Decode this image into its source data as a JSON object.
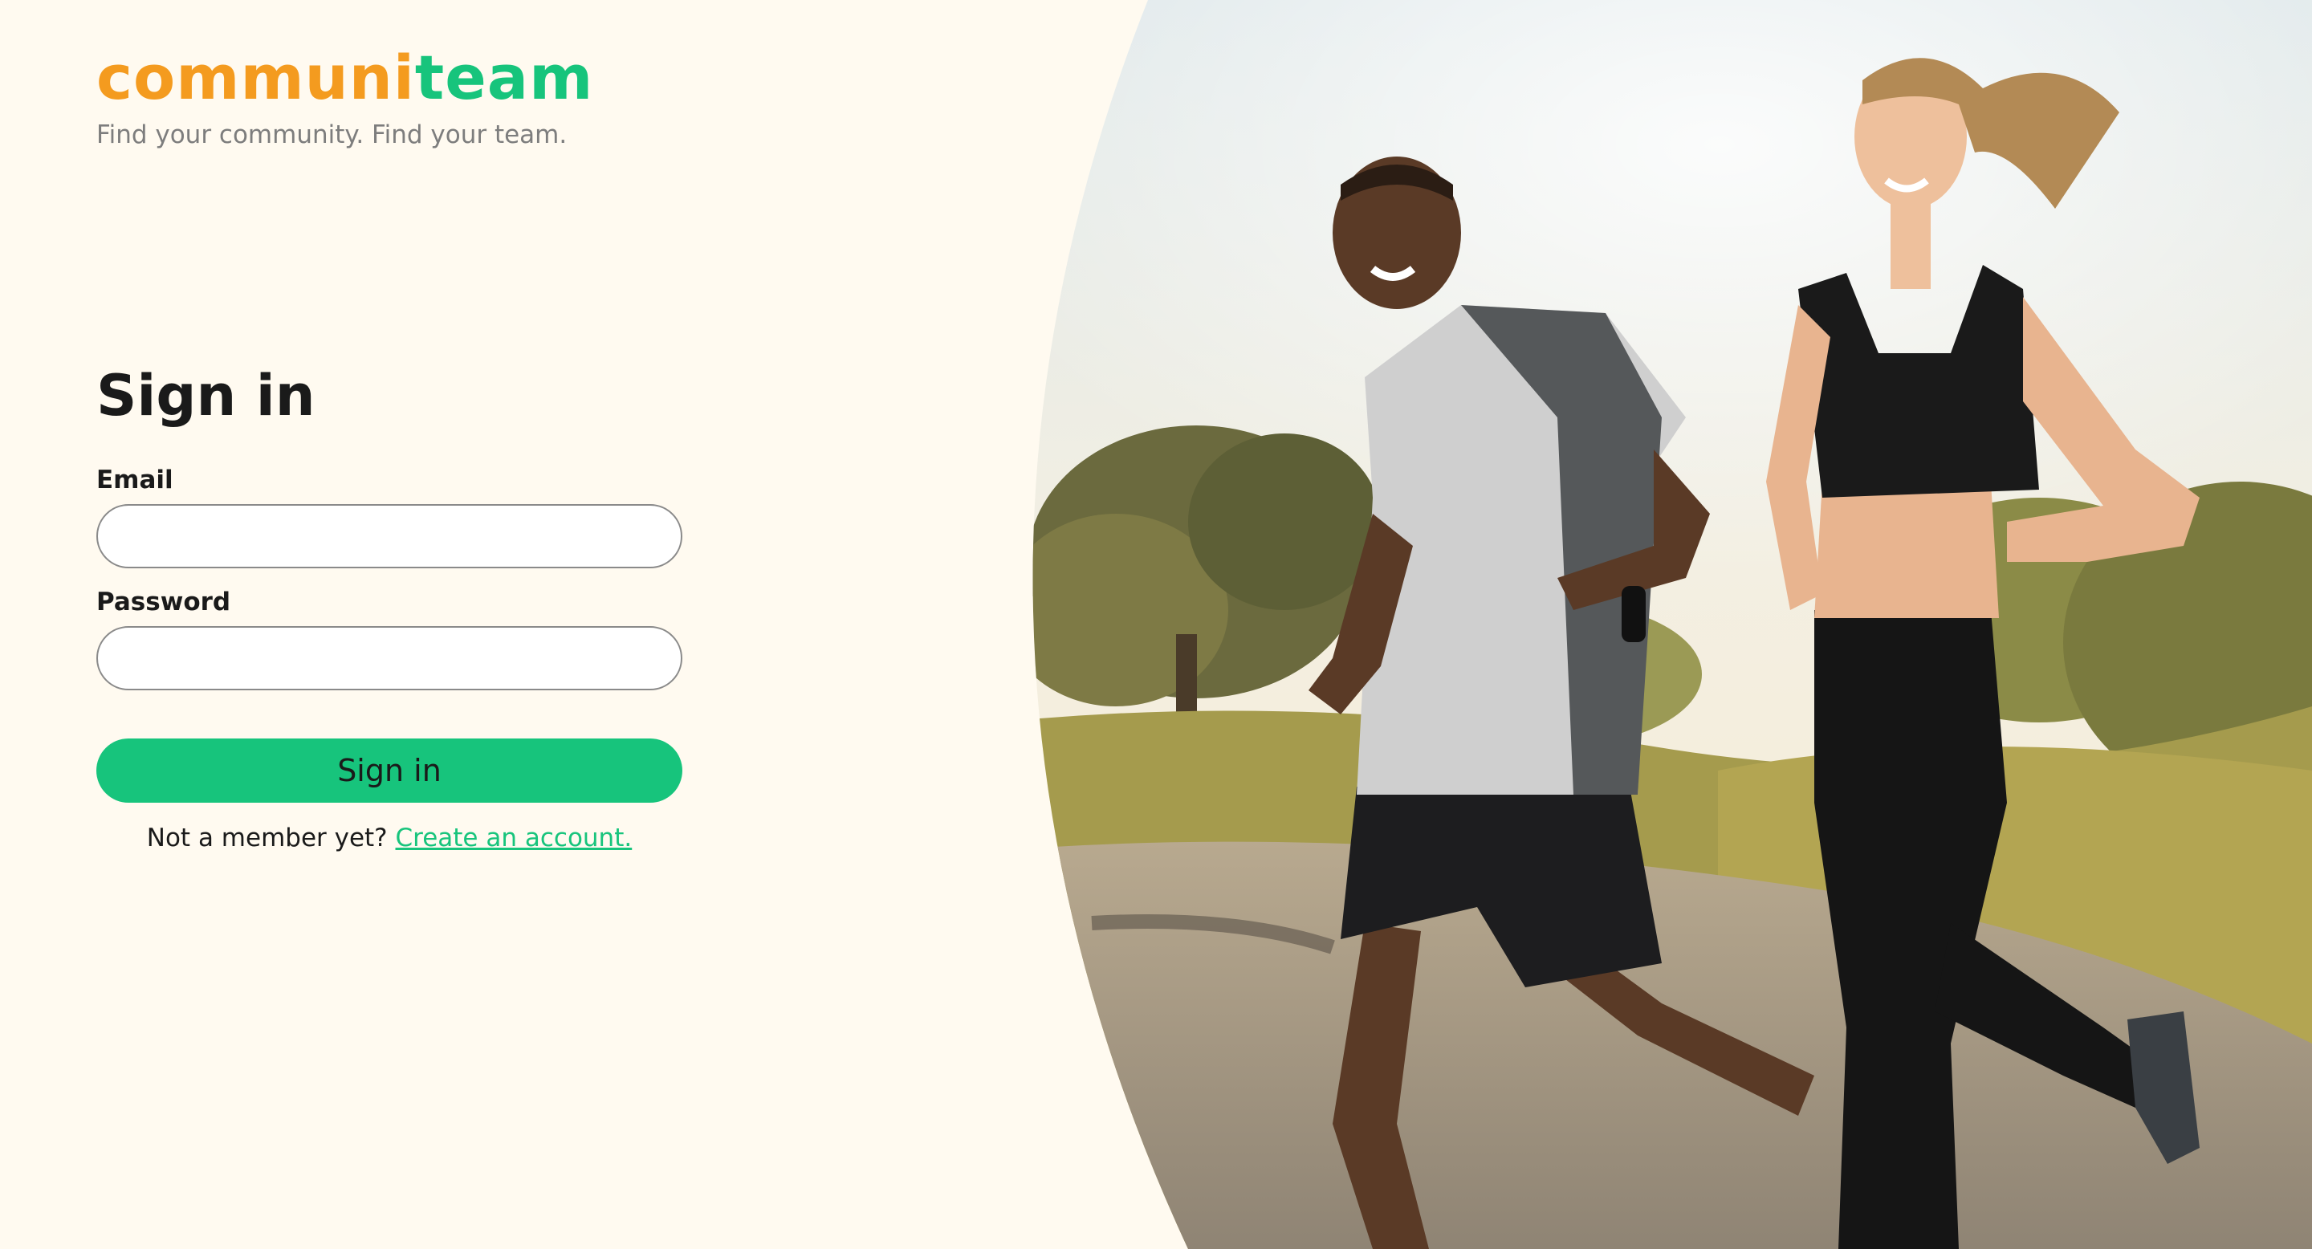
{
  "brand": {
    "logo_part_1": "communi",
    "logo_part_2": "team",
    "tagline": "Find your community. Find your team."
  },
  "signin": {
    "title": "Sign in",
    "email_label": "Email",
    "email_value": "",
    "password_label": "Password",
    "password_value": "",
    "button_label": "Sign in",
    "prompt_text": "Not a member yet? ",
    "create_account_link": "Create an account."
  },
  "colors": {
    "accent_green": "#17c47c",
    "accent_orange": "#f49b1f",
    "background": "#fffaf0"
  },
  "hero": {
    "image_subject": "two-runners-photo"
  }
}
